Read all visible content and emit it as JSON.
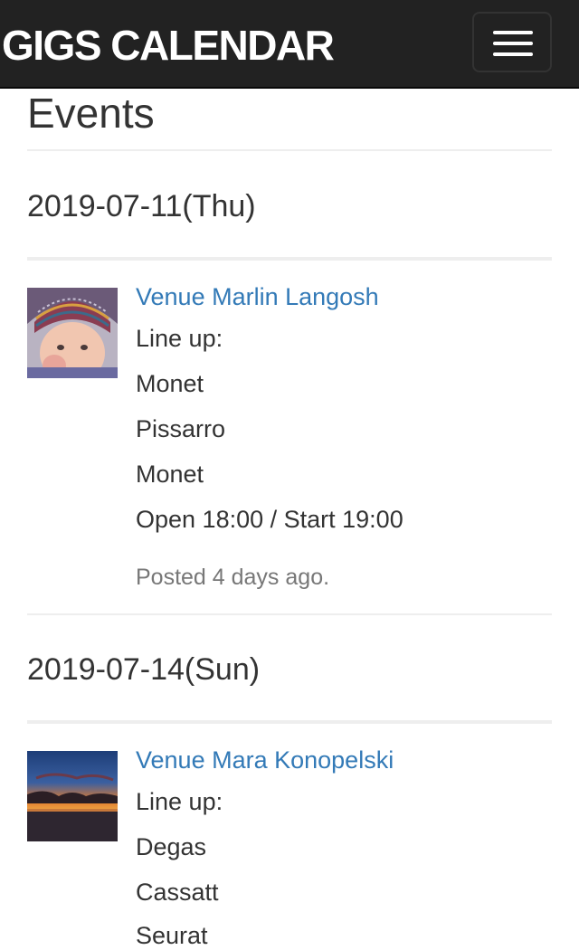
{
  "navbar": {
    "brand": "GIGS CALENDAR",
    "toggle_icon": "hamburger-menu-icon"
  },
  "page": {
    "title": "Events"
  },
  "events": [
    {
      "date": "2019-07-11(Thu)",
      "thumbnail": "child-in-knit-hat-photo",
      "venue": "Venue Marlin Langosh",
      "lineup_label": "Line up:",
      "artists": [
        "Monet",
        "Pissarro",
        "Monet"
      ],
      "times": "Open 18:00 / Start 19:00",
      "posted": "Posted 4 days ago."
    },
    {
      "date": "2019-07-14(Sun)",
      "thumbnail": "sunset-over-water-photo",
      "venue": "Venue Mara Konopelski",
      "lineup_label": "Line up:",
      "artists": [
        "Degas",
        "Cassatt",
        "Seurat"
      ]
    }
  ],
  "colors": {
    "navbar_bg": "#222222",
    "link": "#337ab7",
    "text": "#333333",
    "muted": "#777777"
  }
}
